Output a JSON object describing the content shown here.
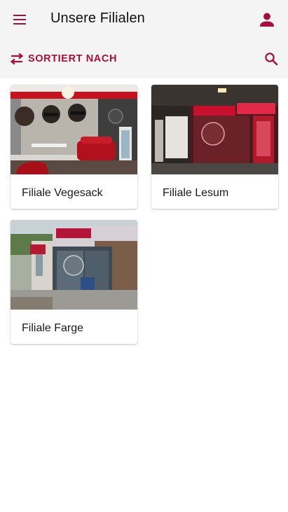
{
  "colors": {
    "accent": "#a3103c",
    "appbar_bg": "#f4f4f4"
  },
  "header": {
    "title": "Unsere Filialen",
    "menu_icon": "hamburger-menu-icon",
    "account_icon": "person-icon"
  },
  "toolbar": {
    "sort_label": "SORTIERT NACH",
    "sort_icon": "swap-arrows-icon",
    "search_icon": "search-icon"
  },
  "stores": [
    {
      "name": "Filiale Vegesack",
      "photo": "salon-interior-photo"
    },
    {
      "name": "Filiale Lesum",
      "photo": "storefront-night-photo"
    },
    {
      "name": "Filiale Farge",
      "photo": "storefront-street-photo"
    }
  ]
}
